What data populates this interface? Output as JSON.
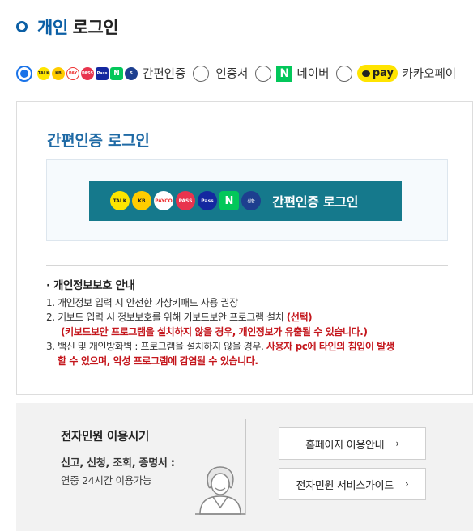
{
  "header": {
    "title_accent": "개인",
    "title_rest": "로그인"
  },
  "login_methods": [
    {
      "label": "간편인증",
      "selected": true
    },
    {
      "label": "인증서",
      "selected": false
    },
    {
      "label": "네이버",
      "selected": false,
      "badge": "N"
    },
    {
      "label": "카카오페이",
      "selected": false,
      "badge": "pay"
    }
  ],
  "provider_icons": [
    {
      "name": "kakaotalk-icon",
      "text": "TALK",
      "color": "#fee500"
    },
    {
      "name": "kb-icon",
      "text": "KB",
      "color": "#ffcc00"
    },
    {
      "name": "payco-icon",
      "text": "PAYCO",
      "color": "#ffffff"
    },
    {
      "name": "pass-icon",
      "text": "PASS",
      "color": "#e8344e"
    },
    {
      "name": "samsung-pass-icon",
      "text": "Pass",
      "color": "#1428a0"
    },
    {
      "name": "naver-icon",
      "text": "N",
      "color": "#03c75a"
    },
    {
      "name": "shinhan-icon",
      "text": "신한",
      "color": "#0046ff"
    }
  ],
  "easy_login": {
    "title": "간편인증 로그인",
    "button_label": "간편인증 로그인"
  },
  "notice": {
    "heading": "· 개인정보보호 안내",
    "item1": "1. 개인정보 입력 시 안전한 가상키패드 사용 권장",
    "item2_prefix": "2. 키보드 입력 시 정보보호를 위해 키보드보안 프로그램 설치 ",
    "item2_red": "(선택)",
    "item2_warning": "(키보드보안 프로그램을 설치하지 않을 경우, 개인정보가 유출될 수 있습니다.)",
    "item3_prefix": "3. 백신 및 개인방화벽 : 프로그램을 설치하지 않을 경우, ",
    "item3_red1": "사용자 pc에 타인의 침입이 발생",
    "item3_red2": "할 수 있으며, 악성 프로그램에 감염될 수 있습니다."
  },
  "service_hours": {
    "title": "전자민원 이용시기",
    "subtitle": "신고, 신청, 조회, 증명서 :",
    "hours": "연중 24시간 이용가능"
  },
  "links": {
    "homepage_guide": "홈페이지 이용안내",
    "service_guide": "전자민원 서비스가이드",
    "chevron": "›"
  },
  "colors": {
    "accent": "#0b5fa5",
    "easy_button": "#15798c",
    "warning": "#c4161c",
    "radio_selected": "#1a73e8"
  }
}
